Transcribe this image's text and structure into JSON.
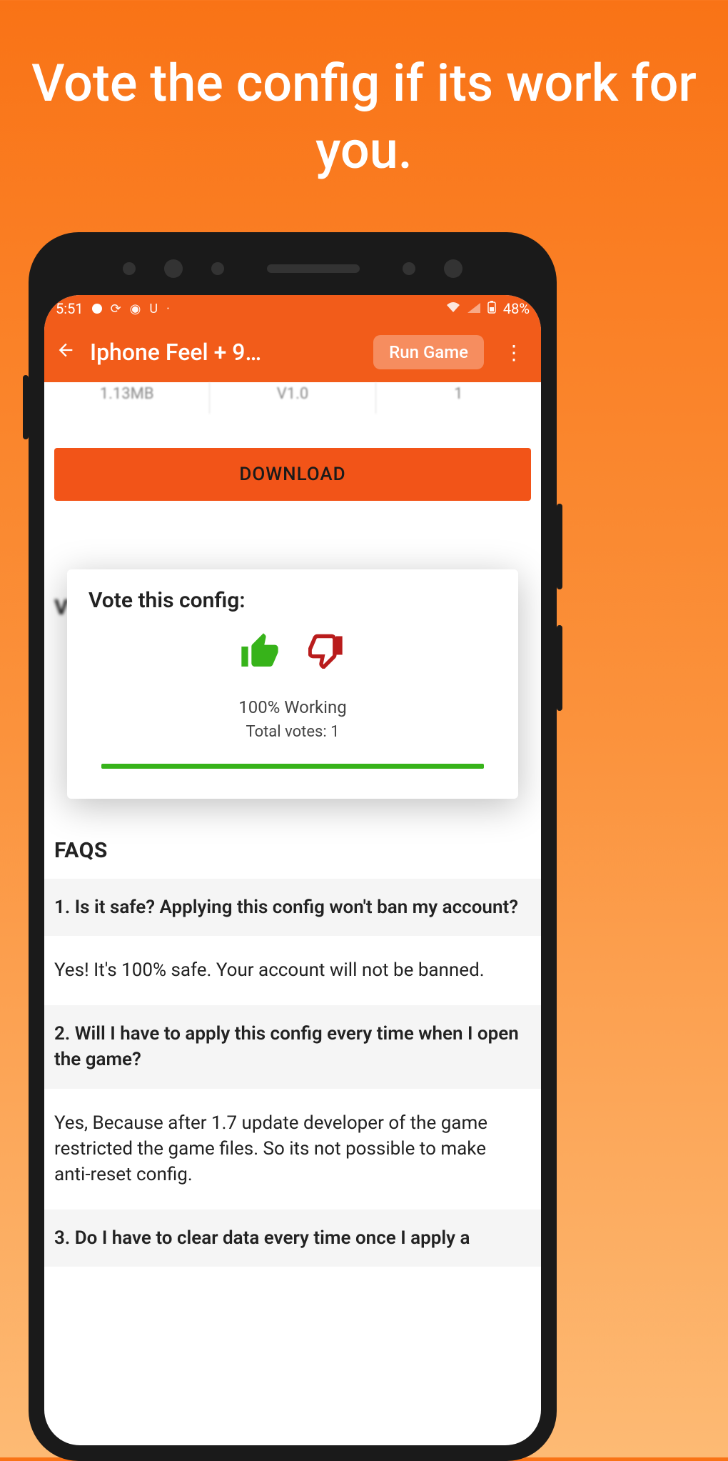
{
  "promo": "Vote the config if its work for you.",
  "status": {
    "time": "5:51",
    "battery": "48%",
    "icons": [
      "●",
      "◐",
      "◉",
      "U",
      "·"
    ]
  },
  "header": {
    "title": "Iphone Feel + 9…",
    "run_label": "Run Game"
  },
  "info": {
    "size": "1.13MB",
    "version": "V1.0",
    "count": "1"
  },
  "download_label": "DOWNLOAD",
  "bg_letter": "V",
  "vote": {
    "title": "Vote this config:",
    "working": "100% Working",
    "total": "Total votes: 1"
  },
  "faqs": {
    "heading": "FAQS",
    "items": [
      {
        "q": "1. Is it safe? Applying this config won't ban my account?",
        "a": "Yes! It's 100% safe. Your account will not be banned."
      },
      {
        "q": "2. Will I have to apply this config every time when I open the game?",
        "a": "Yes, Because after 1.7 update developer of the game restricted the game files. So its not possible to make anti-reset config."
      },
      {
        "q": "3. Do I have to clear data every time once I apply a",
        "a": ""
      }
    ]
  }
}
